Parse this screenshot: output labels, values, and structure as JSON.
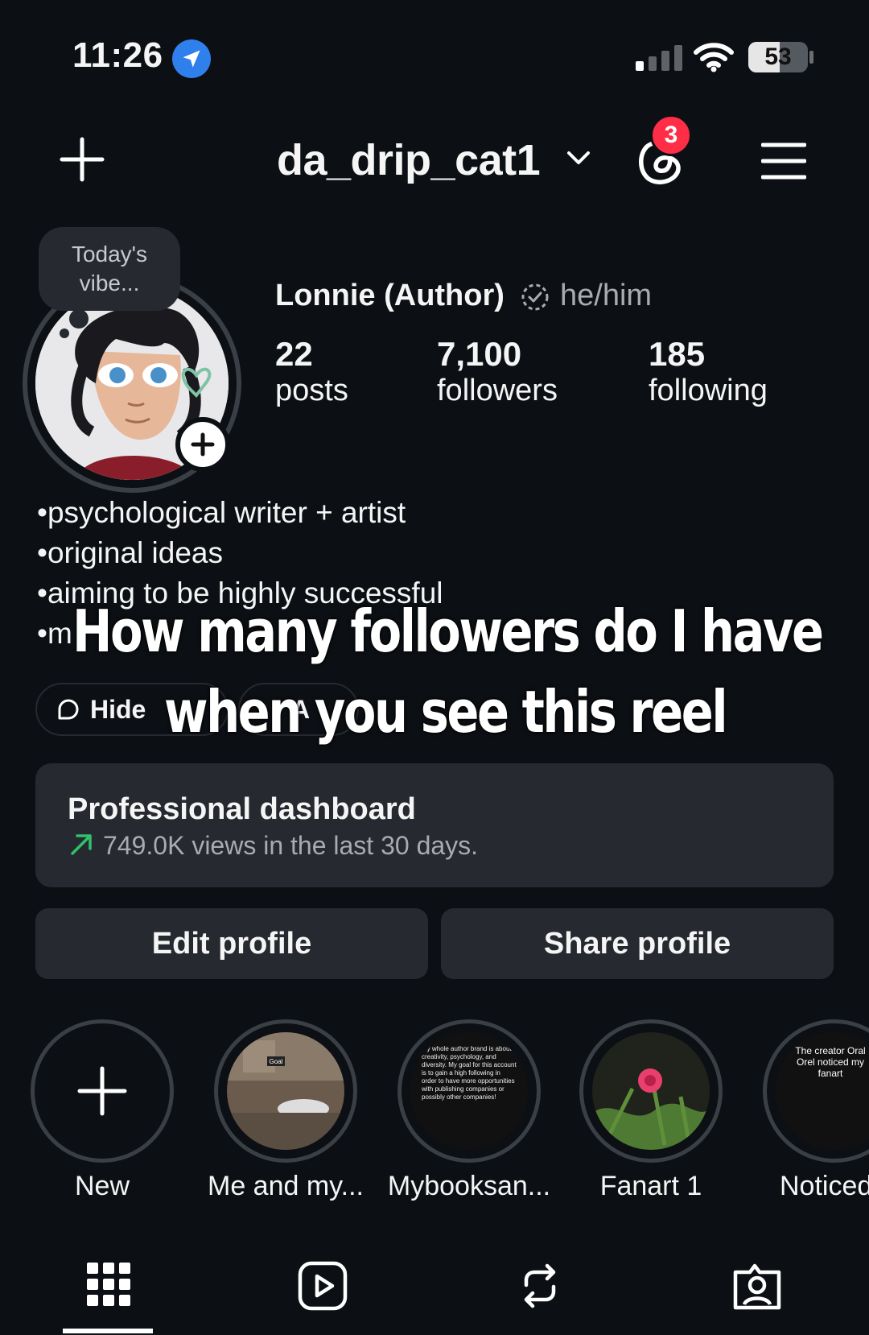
{
  "status_bar": {
    "time": "11:26",
    "battery": "53",
    "battery_level": 0.53
  },
  "header": {
    "username": "da_drip_cat1",
    "notification_count": "3"
  },
  "note": {
    "text": "Today's vibe..."
  },
  "profile": {
    "display_name": "Lonnie (Author)",
    "pronouns": "he/him",
    "stats": [
      {
        "value": "22",
        "label": "posts"
      },
      {
        "value": "7,100",
        "label": "followers"
      },
      {
        "value": "185",
        "label": "following"
      }
    ],
    "bio": [
      "•psychological writer + artist",
      "•original ideas",
      "•aiming to be highly successful",
      "•m"
    ],
    "chips": [
      {
        "label": "Hide"
      },
      {
        "label": "A"
      }
    ]
  },
  "overlay": {
    "line1": "How many followers do I have",
    "line2": "when you see this reel"
  },
  "dashboard": {
    "title": "Professional dashboard",
    "subtitle": "749.0K views in the last 30 days."
  },
  "buttons": {
    "edit": "Edit profile",
    "share": "Share profile"
  },
  "highlights": [
    {
      "label": "New"
    },
    {
      "label": "Me and my..."
    },
    {
      "label": "Mybooksan..."
    },
    {
      "label": "Fanart 1"
    },
    {
      "label": "Noticed"
    }
  ],
  "highlight_thumb_text": {
    "h2": "Goal",
    "h3": "My whole author brand is about creativity, psychology, and diversity. My goal for this account is to gain a high following in order to have more opportunities with publishing companies or possibly other companies!",
    "h5": "The creator Oral Orel noticed my fanart"
  },
  "colors": {
    "accent_green": "#2ec26a",
    "badge_red": "#ff2d46",
    "location_blue": "#2f80ed",
    "surface": "#262a30",
    "background": "#0c1014"
  }
}
